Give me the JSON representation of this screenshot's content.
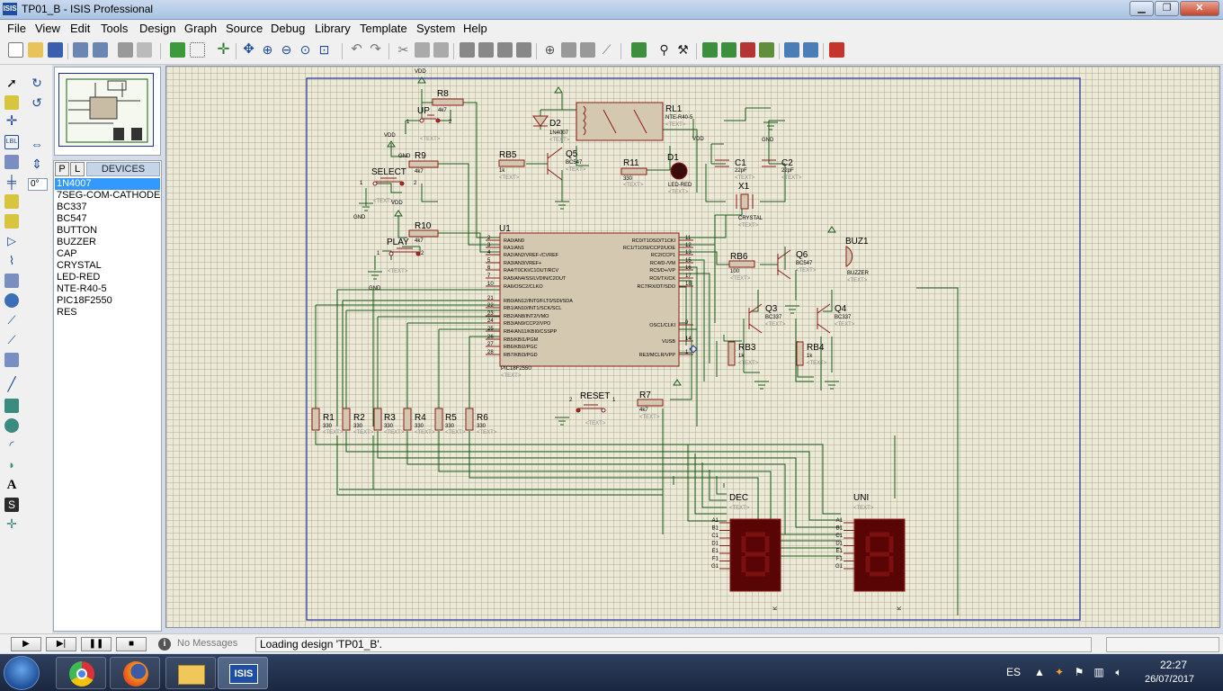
{
  "window": {
    "title": "TP01_B - ISIS Professional",
    "icon_text": "ISIS"
  },
  "menu": [
    "File",
    "View",
    "Edit",
    "Tools",
    "Design",
    "Graph",
    "Source",
    "Debug",
    "Library",
    "Template",
    "System",
    "Help"
  ],
  "left_tools": {
    "angle_value": "0°"
  },
  "devices": {
    "tab_p": "P",
    "tab_l": "L",
    "header": "DEVICES",
    "items": [
      "1N4007",
      "7SEG-COM-CATHODE",
      "BC337",
      "BC547",
      "BUTTON",
      "BUZZER",
      "CAP",
      "CRYSTAL",
      "LED-RED",
      "NTE-R40-5",
      "PIC18F2550",
      "RES"
    ],
    "selected": "1N4007"
  },
  "schematic": {
    "labels": {
      "vdd": "VDD",
      "gnd": "GND",
      "text": "<TEXT>",
      "r8": "R8",
      "r8_val": "4k7",
      "up": "UP",
      "r9": "R9",
      "r9_val": "4k7",
      "select": "SELECT",
      "r10": "R10",
      "r10_val": "4k7",
      "play": "PLAY",
      "d2": "D2",
      "d2_val": "1N4007",
      "rl1": "RL1",
      "rl1_val": "NTE-R40-5",
      "rb5": "RB5",
      "rb5_val": "1k",
      "q5": "Q5",
      "q5_val": "BC547",
      "r11": "R11",
      "r11_val": "330",
      "d1": "D1",
      "d1_val": "LED-RED",
      "c1": "C1",
      "c1_val": "22pF",
      "c2": "C2",
      "c2_val": "22pF",
      "x1": "X1",
      "x1_val": "CRYSTAL",
      "u1": "U1",
      "u1_val": "PIC18F2550",
      "rb6": "RB6",
      "rb6_val": "100",
      "q6": "Q6",
      "q6_val": "BC547",
      "buz1": "BUZ1",
      "buz1_val": "BUZZER",
      "q3": "Q3",
      "q3_val": "BC337",
      "q4": "Q4",
      "q4_val": "BC337",
      "rb3": "RB3",
      "rb3_val": "1k",
      "rb4": "RB4",
      "rb4_val": "1k",
      "reset": "RESET",
      "r7": "R7",
      "r7_val": "4k7",
      "dec": "DEC",
      "uni": "UNI",
      "r_val": "330",
      "pin1": "1",
      "pin2": "2",
      "seg_k": "K"
    },
    "resistors": [
      "R1",
      "R2",
      "R3",
      "R4",
      "R5",
      "R6"
    ],
    "u1_left_pins": [
      {
        "num": "2",
        "name": "RA0/AN0"
      },
      {
        "num": "3",
        "name": "RA1/AN1"
      },
      {
        "num": "4",
        "name": "RA2/AN2/VREF-/CVREF"
      },
      {
        "num": "5",
        "name": "RA3/AN3/VREF+"
      },
      {
        "num": "6",
        "name": "RA4/T0CKI/C1OUT/RCV"
      },
      {
        "num": "7",
        "name": "RA5/AN4/SS/LVDIN/C2OUT"
      },
      {
        "num": "10",
        "name": "RA6/OSC2/CLKO"
      },
      {
        "num": "21",
        "name": "RB0/AN12/INT0/FLT0/SDI/SDA"
      },
      {
        "num": "22",
        "name": "RB1/AN10/INT1/SCK/SCL"
      },
      {
        "num": "23",
        "name": "RB2/AN8/INT2/VMO"
      },
      {
        "num": "24",
        "name": "RB3/AN9/CCP2/VPO"
      },
      {
        "num": "25",
        "name": "RB4/AN11/KBI0/CSSPP"
      },
      {
        "num": "26",
        "name": "RB5/KBI1/PGM"
      },
      {
        "num": "27",
        "name": "RB6/KBI2/PGC"
      },
      {
        "num": "28",
        "name": "RB7/KBI3/PGD"
      }
    ],
    "u1_right_pins": [
      {
        "num": "11",
        "name": "RC0/T1OSO/T1CKI"
      },
      {
        "num": "12",
        "name": "RC1/T1OSI/CCP2/UOE"
      },
      {
        "num": "13",
        "name": "RC2/CCP1"
      },
      {
        "num": "15",
        "name": "RC4/D-/VM"
      },
      {
        "num": "16",
        "name": "RC5/D+/VP"
      },
      {
        "num": "17",
        "name": "RC6/TX/CK"
      },
      {
        "num": "18",
        "name": "RC7/RX/DT/SDO"
      },
      {
        "num": "9",
        "name": "OSC1/CLKI"
      },
      {
        "num": "14",
        "name": "VUSB"
      },
      {
        "num": "1",
        "name": "RE3/MCLR/VPP"
      }
    ],
    "seg_pins": [
      "A",
      "B",
      "C",
      "D",
      "E",
      "F",
      "G"
    ]
  },
  "status": {
    "play": "▶",
    "step": "▶|",
    "pause": "❚❚",
    "stop": "■",
    "info_icon": "i",
    "messages": "No Messages",
    "text": "Loading design 'TP01_B'."
  },
  "taskbar": {
    "language": "ES",
    "time": "22:27",
    "date": "26/07/2017",
    "apps": [
      "windows-start",
      "chrome",
      "firefox",
      "file-explorer",
      "isis"
    ]
  },
  "colors": {
    "wire": "#1a5c1a",
    "component": "#8b1a1a",
    "body_fill": "#d4c9b0",
    "sheet_border": "#1f2ea0",
    "seg_bg": "#5a0505",
    "seg_on": "#7a1010"
  }
}
